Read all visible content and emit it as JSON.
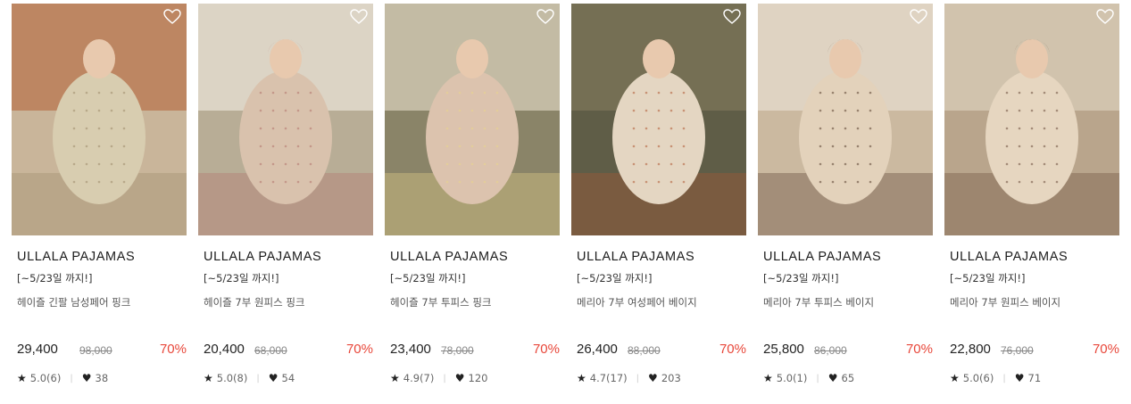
{
  "products": [
    {
      "brand": "ULLALA PAJAMAS",
      "promo": "[~5/23일 까지!]",
      "name": "헤이즐 긴팔 남성페어 핑크",
      "price": "29,400",
      "original_price": "98,000",
      "discount": "70%",
      "rating": "5.0(6)",
      "likes": "38",
      "palette": {
        "bg": "#c9b59a",
        "wall": "#b8774f",
        "figure": "#d8cdb0",
        "accent": "#9c8a6a"
      }
    },
    {
      "brand": "ULLALA PAJAMAS",
      "promo": "[~5/23일 까지!]",
      "name": "헤이즐 7부 원피스 핑크",
      "price": "20,400",
      "original_price": "68,000",
      "discount": "70%",
      "rating": "5.0(8)",
      "likes": "54",
      "palette": {
        "bg": "#b8ad96",
        "wall": "#e8e2d4",
        "figure": "#d9c2ad",
        "accent": "#b2746e"
      }
    },
    {
      "brand": "ULLALA PAJAMAS",
      "promo": "[~5/23일 까지!]",
      "name": "헤이즐 7부 투피스 핑크",
      "price": "23,400",
      "original_price": "78,000",
      "discount": "70%",
      "rating": "4.9(7)",
      "likes": "120",
      "palette": {
        "bg": "#8a8468",
        "wall": "#d6cdb8",
        "figure": "#dcc3ae",
        "accent": "#e9d58c"
      }
    },
    {
      "brand": "ULLALA PAJAMAS",
      "promo": "[~5/23일 까지!]",
      "name": "메리아 7부 여성페어 베이지",
      "price": "26,400",
      "original_price": "88,000",
      "discount": "70%",
      "rating": "4.7(17)",
      "likes": "203",
      "palette": {
        "bg": "#5f5d47",
        "wall": "#7c7558",
        "figure": "#e4d6c2",
        "accent": "#b05a34"
      }
    },
    {
      "brand": "ULLALA PAJAMAS",
      "promo": "[~5/23일 까지!]",
      "name": "메리아 7부 투피스 베이지",
      "price": "25,800",
      "original_price": "86,000",
      "discount": "70%",
      "rating": "5.0(1)",
      "likes": "65",
      "palette": {
        "bg": "#cbb9a0",
        "wall": "#e5dccd",
        "figure": "#e3d2bb",
        "accent": "#5a4030"
      }
    },
    {
      "brand": "ULLALA PAJAMAS",
      "promo": "[~5/23일 까지!]",
      "name": "메리아 7부 원피스 베이지",
      "price": "22,800",
      "original_price": "76,000",
      "discount": "70%",
      "rating": "5.0(6)",
      "likes": "71",
      "palette": {
        "bg": "#b9a58c",
        "wall": "#d9cdb8",
        "figure": "#e6d6c0",
        "accent": "#6a4d3a"
      }
    }
  ]
}
